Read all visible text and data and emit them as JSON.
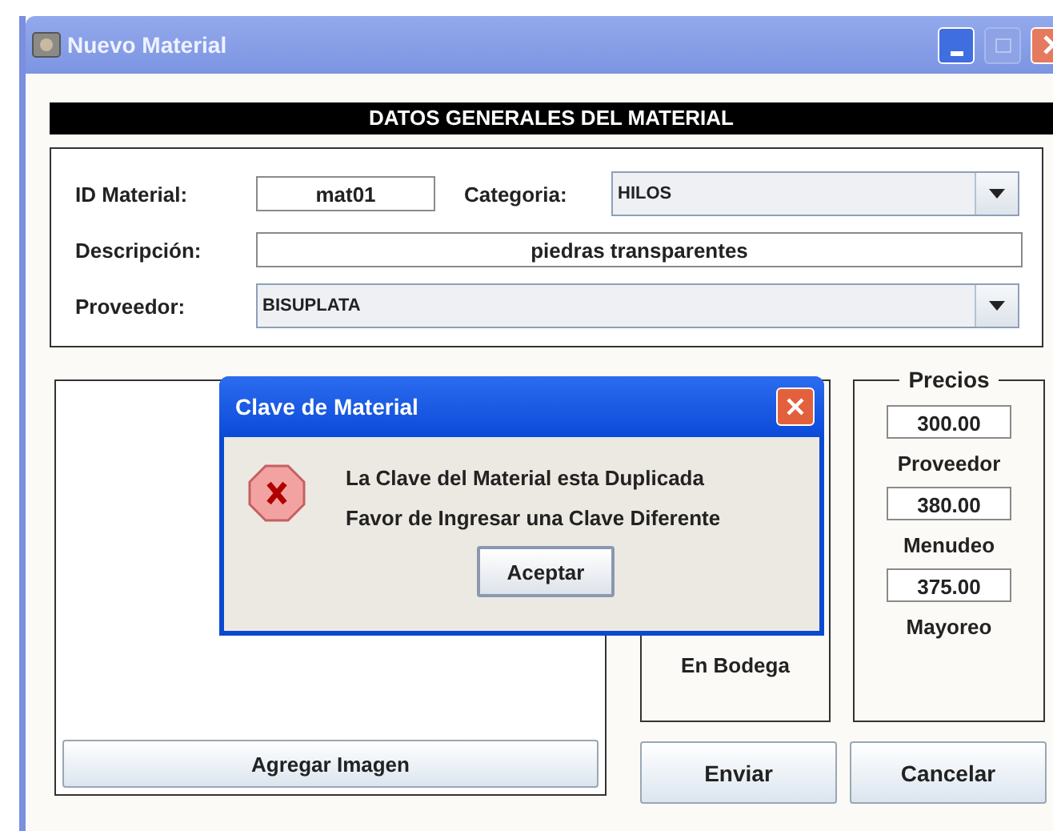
{
  "window": {
    "title": "Nuevo Material"
  },
  "section_header": "DATOS GENERALES DEL MATERIAL",
  "form": {
    "id_label": "ID Material:",
    "id_value": "mat01",
    "category_label": "Categoria:",
    "category_value": "HILOS",
    "description_label": "Descripción:",
    "description_value": "piedras transparentes",
    "supplier_label": "Proveedor:",
    "supplier_value": "BISUPLATA"
  },
  "image_panel": {
    "button": "Agregar Imagen"
  },
  "stock_panel": {
    "label": "En Bodega"
  },
  "prices_panel": {
    "title": "Precios",
    "prices": [
      {
        "value": "300.00",
        "label": "Proveedor"
      },
      {
        "value": "380.00",
        "label": "Menudeo"
      },
      {
        "value": "375.00",
        "label": "Mayoreo"
      }
    ]
  },
  "buttons": [
    "Enviar",
    "Cancelar"
  ],
  "dialog": {
    "title": "Clave de Material",
    "messages": [
      "La Clave del Material esta Duplicada",
      "Favor de Ingresar una Clave Diferente"
    ],
    "button": "Aceptar"
  }
}
